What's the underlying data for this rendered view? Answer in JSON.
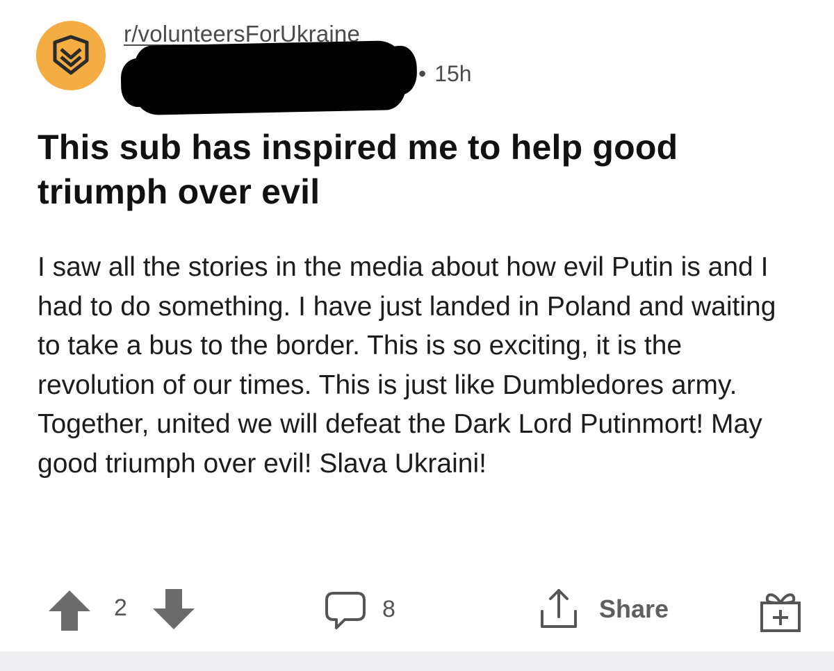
{
  "post": {
    "subreddit": "r/volunteersForUkraine",
    "separator": "•",
    "time": "15h",
    "title": "This sub has inspired me to help good triumph over evil",
    "body": "I saw all the stories in the media about how evil Putin is and I had to do something. I have just landed in Poland and waiting to take a bus to the border. This is so exciting, it is the revolution of our times. This is just like Dumbledores army. Together, united we will defeat the Dark Lord Putinmort! May good triumph over evil! Slava Ukraini!"
  },
  "actions": {
    "vote_count": "2",
    "comment_count": "8",
    "share_label": "Share"
  },
  "icons": {
    "subreddit_avatar": "chevron-badge-icon",
    "upvote": "upvote-arrow-icon",
    "downvote": "downvote-arrow-icon",
    "comment": "comment-bubble-icon",
    "share": "share-upload-icon",
    "award": "gift-award-icon"
  },
  "colors": {
    "avatar_bg": "#f3ad43",
    "vote_arrow": "#6b6b6b",
    "footer_bg": "#efeff1"
  }
}
